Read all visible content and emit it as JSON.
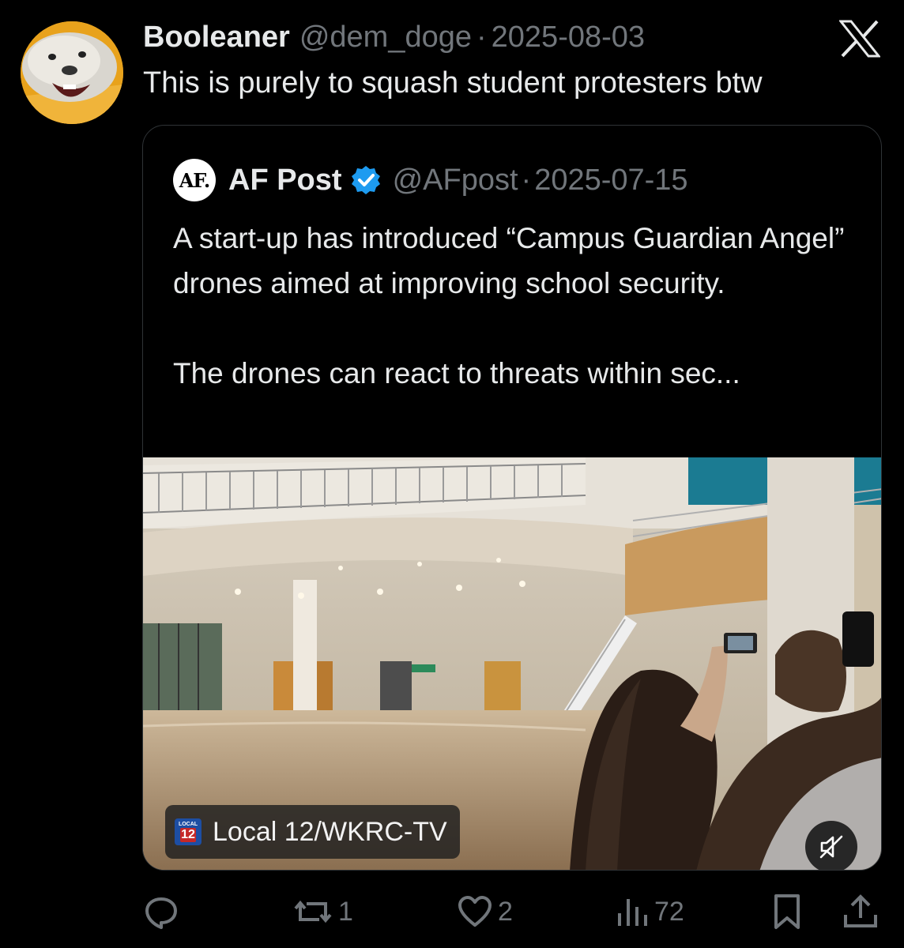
{
  "tweet": {
    "author_name": "Booleaner",
    "handle": "@dem_doge",
    "date": "2025-08-03",
    "separator": "·",
    "text": "This is purely to squash student protesters btw"
  },
  "quote": {
    "avatar_text": "AF.",
    "author_name": "AF Post",
    "handle": "@AFpost",
    "date": "2025-07-15",
    "separator": "·",
    "paragraph1": "A start-up has introduced “Campus Guardian Angel” drones aimed at improving school security.",
    "paragraph2": "The drones can react to threats within sec...",
    "media": {
      "source_label": "Local 12/WKRC-TV",
      "logo_text_top": "LOCAL",
      "logo_text_num": "12"
    }
  },
  "actions": {
    "replies": "",
    "reposts": "1",
    "likes": "2",
    "views": "72"
  },
  "icons": {
    "platform": "x-logo-icon",
    "verified": "verified-badge-icon",
    "mute": "muted-speaker-icon",
    "reply": "reply-icon",
    "repost": "repost-icon",
    "like": "heart-icon",
    "views": "views-icon",
    "bookmark": "bookmark-icon",
    "share": "share-icon"
  },
  "colors": {
    "background": "#000000",
    "text": "#e7e9ea",
    "muted": "#71767b",
    "verified": "#1d9bf0"
  }
}
